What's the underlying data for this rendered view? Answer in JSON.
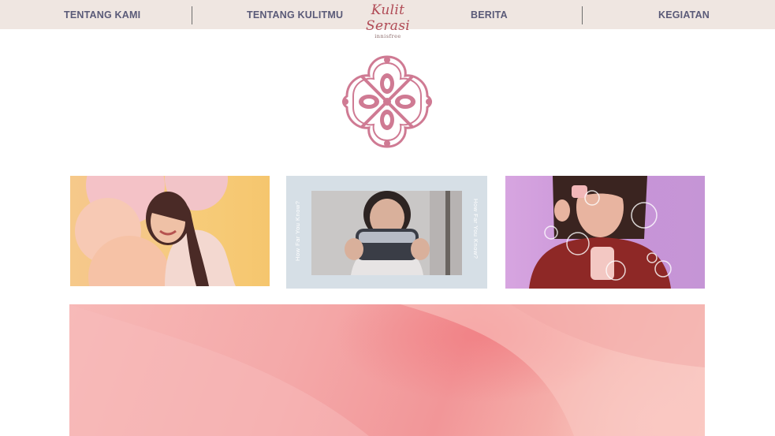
{
  "nav": {
    "items": [
      {
        "label": "TENTANG KAMI"
      },
      {
        "label": "TENTANG KULITMU"
      },
      {
        "label": "BERITA"
      },
      {
        "label": "KEGIATAN"
      }
    ],
    "brand": {
      "name": "Kulit Serasi",
      "sub": "innisfree"
    }
  },
  "cards": [
    {
      "image": "woman-with-balloons-photo"
    },
    {
      "image": "woman-holding-pouch-photo",
      "vertical_text": "How Far You Know?"
    },
    {
      "image": "woman-with-bubbles-photo"
    }
  ],
  "hero": {
    "image": "pink-fabric-background"
  },
  "colors": {
    "nav_bg": "#efe6e1",
    "nav_text": "#5a5a78",
    "brand": "#b04a55",
    "emblem": "#cf7a93",
    "hero_pink": "#f4a9a9"
  }
}
